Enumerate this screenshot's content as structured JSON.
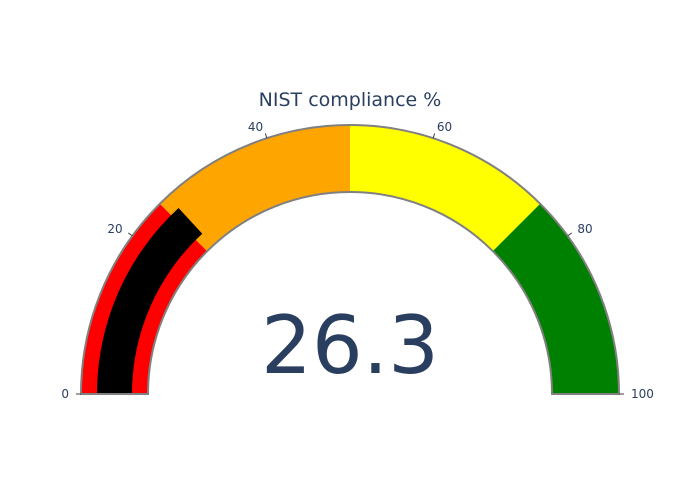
{
  "chart_data": {
    "type": "gauge",
    "title": "NIST compliance %",
    "value": 26.3,
    "value_label": "26.3",
    "range": [
      0,
      100
    ],
    "ticks": [
      0,
      20,
      40,
      60,
      80,
      100
    ],
    "tick_labels": [
      "0",
      "20",
      "40",
      "60",
      "80",
      "100"
    ],
    "steps": [
      {
        "range": [
          0,
          25
        ],
        "color": "#ff0000"
      },
      {
        "range": [
          25,
          50
        ],
        "color": "#ffa500"
      },
      {
        "range": [
          50,
          75
        ],
        "color": "#ffff00"
      },
      {
        "range": [
          75,
          100
        ],
        "color": "#008000"
      }
    ],
    "bar_color": "#000000",
    "border_color": "#808080",
    "text_color": "#2a3f5f"
  }
}
